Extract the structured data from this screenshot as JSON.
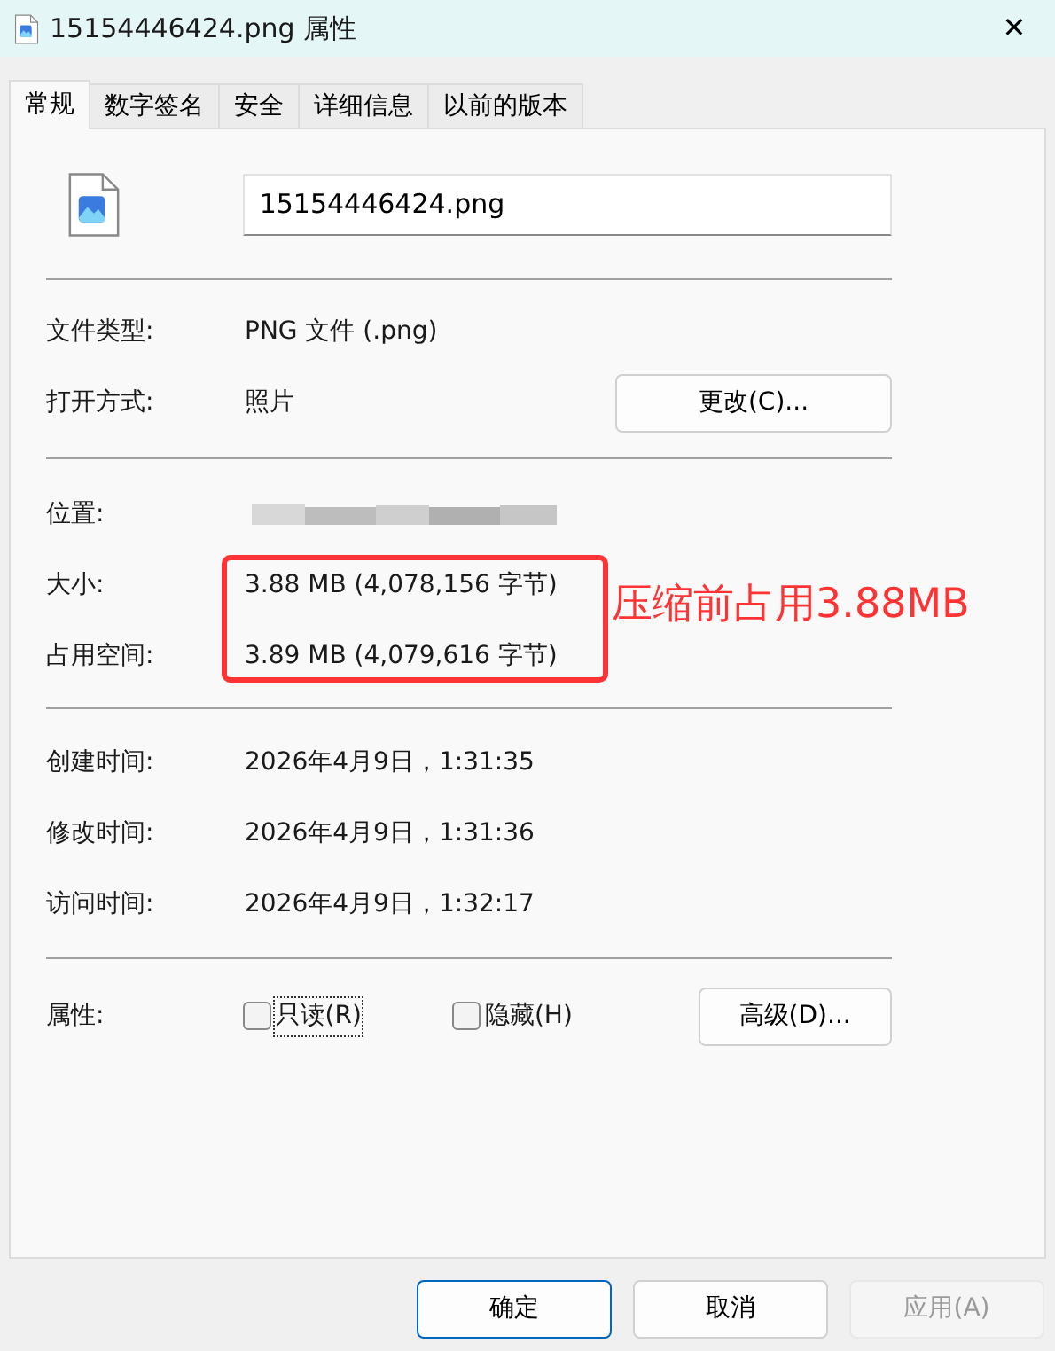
{
  "window": {
    "title": "15154446424.png 属性",
    "close": "✕"
  },
  "tabs": [
    {
      "label": "常规",
      "selected": true
    },
    {
      "label": "数字签名",
      "selected": false
    },
    {
      "label": "安全",
      "selected": false
    },
    {
      "label": "详细信息",
      "selected": false
    },
    {
      "label": "以前的版本",
      "selected": false
    }
  ],
  "file_name": {
    "value": "15154446424.png"
  },
  "sections": [
    [
      {
        "label": "文件类型:",
        "value": "PNG 文件 (.png)"
      },
      {
        "label": "打开方式:",
        "value": "照片",
        "button": "更改(C)..."
      }
    ],
    [
      {
        "label": "位置:",
        "kind": "redacted"
      },
      {
        "label": "大小:",
        "value": "3.88 MB (4,078,156 字节)"
      },
      {
        "label": "占用空间:",
        "value": "3.89 MB (4,079,616 字节)"
      }
    ],
    [
      {
        "label": "创建时间:",
        "value": "2026年4月9日，1:31:35"
      },
      {
        "label": "修改时间:",
        "value": "2026年4月9日，1:31:36"
      },
      {
        "label": "访问时间:",
        "value": "2026年4月9日，1:32:17"
      }
    ]
  ],
  "attributes": {
    "label": "属性:",
    "checkboxes": [
      {
        "label": "只读(R)",
        "checked": false,
        "focused": true
      },
      {
        "label": "隐藏(H)",
        "checked": false,
        "focused": false
      }
    ],
    "button": "高级(D)..."
  },
  "annotation": {
    "text": "压缩前占用3.88MB"
  },
  "buttons": [
    {
      "label": "确定",
      "default": true,
      "disabled": false
    },
    {
      "label": "取消",
      "default": false,
      "disabled": false
    },
    {
      "label": "应用(A)",
      "default": false,
      "disabled": true
    }
  ]
}
